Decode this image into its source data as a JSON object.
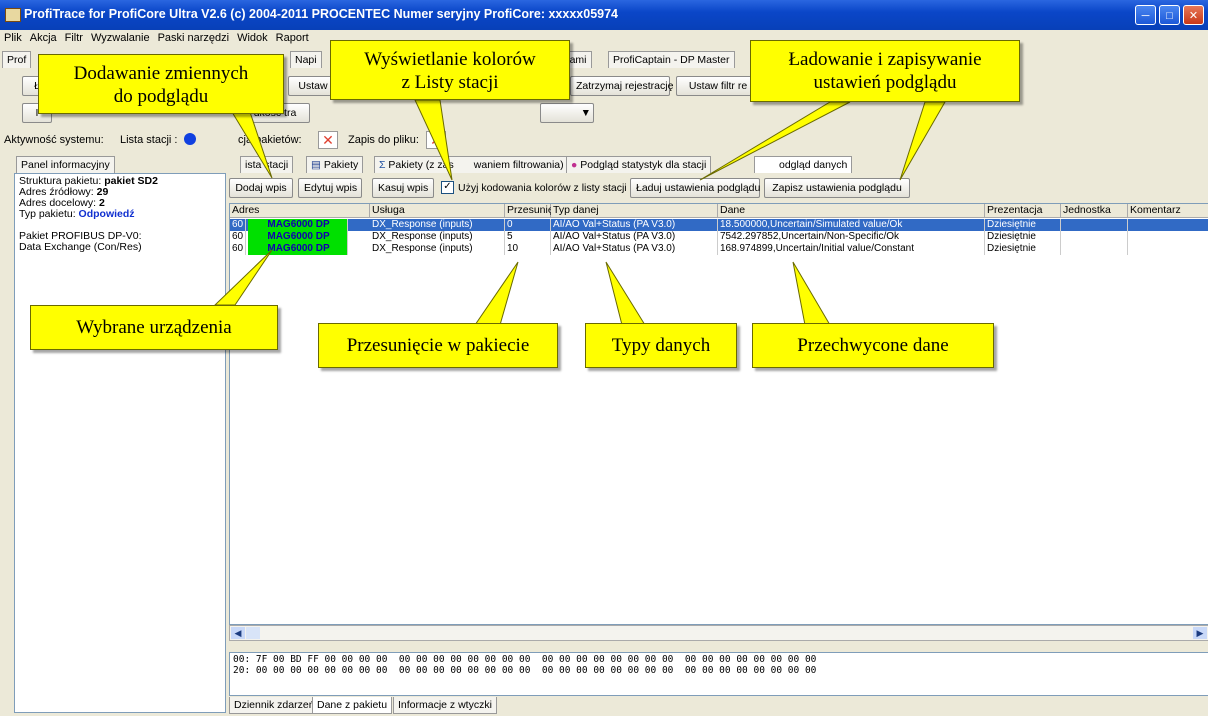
{
  "window": {
    "title": "ProfiTrace for ProfiCore Ultra V2.6 (c) 2004-2011 PROCENTEC  Numer seryjny ProfiCore: xxxxx05974"
  },
  "menu": [
    "Plik",
    "Akcja",
    "Filtr",
    "Wyzwalanie",
    "Paski narzędzi",
    "Widok",
    "Raport"
  ],
  "top_tabs": [
    "Prof",
    "Napi",
    "entami",
    "ProfiCaptain - DP Master"
  ],
  "toolbar": {
    "b1": "Ł",
    "b2": "Ustaw",
    "record_stop": "Zatrzymaj rejestrację",
    "filter": "Ustaw filtr re",
    "b3": "I",
    "speed": "dkość tra"
  },
  "status": {
    "activity": "Aktywność systemu:",
    "station_list": "Lista stacji :",
    "packets": "cja pakietów:",
    "file": "Zapis do pliku:"
  },
  "left": {
    "tab": "Panel informacyjny",
    "lines": [
      {
        "label": "Struktura pakietu:",
        "value": "pakiet SD2"
      },
      {
        "label": "Adres źródłowy:",
        "value": "29"
      },
      {
        "label": "Adres docelowy:",
        "value": "2"
      },
      {
        "label": "Typ pakietu:",
        "value": "Odpowiedź"
      }
    ],
    "extra1": "Pakiet PROFIBUS DP-V0:",
    "extra2": " Data Exchange (Con/Res)"
  },
  "view_tabs": [
    "ista stacji",
    "Pakiety",
    "Pakiety (z zas",
    "waniem filtrowania)",
    "Podgląd statystyk dla stacji",
    "odgląd danych"
  ],
  "actions": {
    "add": "Dodaj wpis",
    "edit": "Edytuj wpis",
    "delete": "Kasuj wpis",
    "use_colors": "Użyj kodowania kolorów z listy stacji",
    "load": "Ładuj ustawienia podglądu",
    "save": "Zapisz ustawienia podglądu"
  },
  "table": {
    "headers": [
      "Adres",
      "Usługa",
      "Przesunię",
      "Typ danej",
      "Dane",
      "Prezentacja",
      "Jednostka",
      "Komentarz"
    ],
    "rows": [
      {
        "addr": "60",
        "device": "MAG6000 DP",
        "service": "DX_Response (inputs)",
        "offset": "0",
        "type": "AI/AO Val+Status (PA V3.0)",
        "data": "18.500000,Uncertain/Simulated value/Ok",
        "pres": "Dziesiętnie",
        "selected": true
      },
      {
        "addr": "60",
        "device": "MAG6000 DP",
        "service": "DX_Response (inputs)",
        "offset": "5",
        "type": "AI/AO Val+Status (PA V3.0)",
        "data": "7542.297852,Uncertain/Non-Specific/Ok",
        "pres": "Dziesiętnie",
        "selected": false
      },
      {
        "addr": "60",
        "device": "MAG6000 DP",
        "service": "DX_Response (inputs)",
        "offset": "10",
        "type": "AI/AO Val+Status (PA V3.0)",
        "data": "168.974899,Uncertain/Initial value/Constant",
        "pres": "Dziesiętnie",
        "selected": false
      }
    ]
  },
  "hex": {
    "line1": "00: 7F 00 BD FF 00 00 00 00  00 00 00 00 00 00 00 00  00 00 00 00 00 00 00 00  00 00 00 00 00 00 00 00",
    "line2": "20: 00 00 00 00 00 00 00 00  00 00 00 00 00 00 00 00  00 00 00 00 00 00 00 00  00 00 00 00 00 00 00 00"
  },
  "bottom_tabs": [
    "Dziennik zdarzeń",
    "Dane z pakietu",
    "Informacje z wtyczki"
  ],
  "callouts": {
    "add_vars": [
      "Dodawanie zmiennych",
      "do podglądu"
    ],
    "colors": [
      "Wyświetlanie kolorów",
      "z Listy stacji"
    ],
    "load_save": [
      "Ładowanie i zapisywanie",
      "ustawień podglądu"
    ],
    "devices": "Wybrane urządzenia",
    "offset": "Przesunięcie w pakiecie",
    "types": "Typy danych",
    "captured": "Przechwycone dane"
  },
  "colors": {
    "titlebar": "#0a46c8",
    "selection": "#316ac5",
    "device": "#00e000",
    "callout": "#ffff00"
  }
}
